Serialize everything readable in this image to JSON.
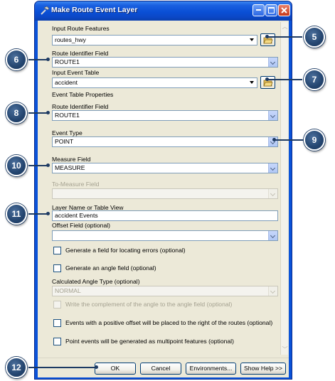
{
  "window": {
    "title": "Make Route Event Layer",
    "buttons": {
      "minimize": "_",
      "maximize": "□",
      "close": "✕"
    }
  },
  "form": {
    "input_route_features": {
      "label": "Input Route Features",
      "value": "routes_hwy"
    },
    "route_identifier_field": {
      "label": "Route Identifier Field",
      "value": "ROUTE1"
    },
    "input_event_table": {
      "label": "Input Event Table",
      "value": "accident"
    },
    "event_table_properties": {
      "label": "Event Table Properties"
    },
    "event_route_identifier_field": {
      "label": "Route Identifier Field",
      "value": "ROUTE1"
    },
    "event_type": {
      "label": "Event Type",
      "value": "POINT"
    },
    "measure_field": {
      "label": "Measure Field",
      "value": "MEASURE"
    },
    "to_measure_field": {
      "label": "To-Measure Field",
      "value": ""
    },
    "layer_name": {
      "label": "Layer Name or Table View",
      "value": "accident Events"
    },
    "offset_field": {
      "label": "Offset Field (optional)",
      "value": ""
    },
    "generate_error_field": {
      "label": "Generate a field for locating errors (optional)",
      "checked": false
    },
    "generate_angle_field": {
      "label": "Generate an angle field (optional)",
      "checked": false
    },
    "calculated_angle_type": {
      "label": "Calculated Angle Type (optional)",
      "value": "NORMAL"
    },
    "write_complement": {
      "label": "Write the complement of the angle to the angle field (optional)",
      "checked": false
    },
    "positive_offset_right": {
      "label": "Events with a positive offset will be placed to the right of the routes (optional)",
      "checked": false
    },
    "multipoint_features": {
      "label": "Point events will be generated as multipoint features (optional)",
      "checked": false
    }
  },
  "buttons": {
    "ok": "OK",
    "cancel": "Cancel",
    "environments": "Environments...",
    "show_help": "Show Help >>"
  },
  "callouts": [
    "5",
    "6",
    "7",
    "8",
    "9",
    "10",
    "11",
    "12"
  ],
  "colors": {
    "titlebar": "#0a4fd6",
    "dialog_bg": "#ece9d8",
    "callout": "#24456f"
  }
}
